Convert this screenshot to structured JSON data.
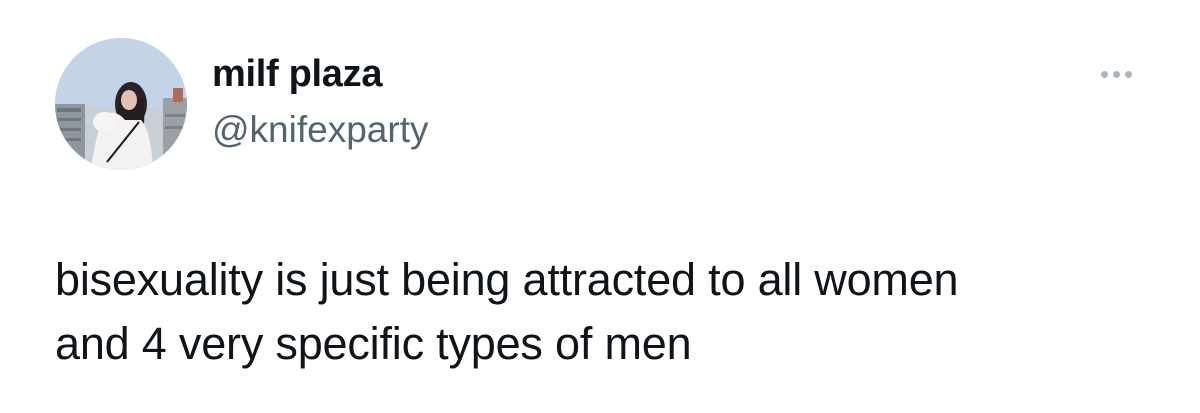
{
  "tweet": {
    "author": {
      "display_name": "milf plaza",
      "handle": "@knifexparty",
      "avatar_icon": "profile-photo"
    },
    "more_icon": "more-horizontal-icon",
    "text_lines": [
      "bisexuality is just being attracted to all women",
      "and 4 very specific types of men"
    ]
  },
  "colors": {
    "text_primary": "#0f1419",
    "text_secondary": "#536471",
    "icon_muted": "#aab4bd",
    "background": "#ffffff"
  }
}
